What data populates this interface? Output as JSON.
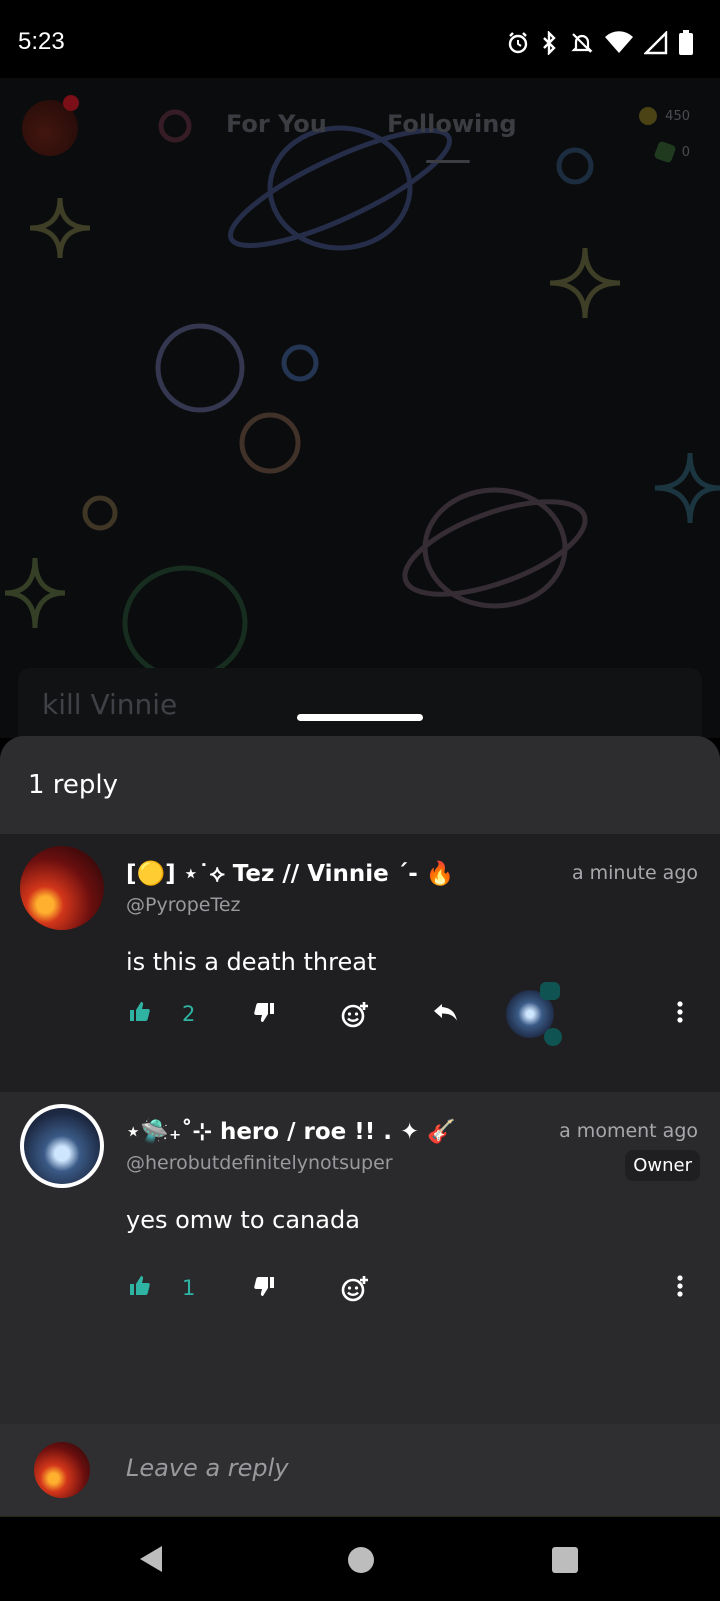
{
  "status_bar": {
    "time": "5:23",
    "icons": [
      "alarm-icon",
      "bluetooth-icon",
      "bell-off-icon",
      "wifi-icon",
      "signal-icon",
      "battery-icon"
    ]
  },
  "feed": {
    "tabs": [
      {
        "label": "For You",
        "active": false
      },
      {
        "label": "Following",
        "active": true
      }
    ],
    "coins": {
      "amount": "450",
      "gems": "0"
    },
    "caption_preview": "kill Vinnie"
  },
  "replies_sheet": {
    "title": "1 reply",
    "comments": [
      {
        "display_name": "[🟡] ⋆˙⟡ Tez // Vinnie ˊ- 🔥",
        "handle": "@PyropeTez",
        "time": "a minute ago",
        "text": "is this a death threat",
        "likes": "2"
      },
      {
        "display_name": "⋆🛸₊˚⊹ hero / roe !! . ✦ 🎸",
        "handle": "@herobutdefinitelynotsuper",
        "time": "a moment ago",
        "badge": "Owner",
        "text": "yes omw to canada",
        "likes": "1"
      }
    ],
    "reply_input": {
      "placeholder": "Leave a reply"
    }
  },
  "colors": {
    "accent": "#2fb3a3",
    "sheet_bg": "#2a2a2c",
    "comment_highlight_bg": "#1f1f21"
  }
}
